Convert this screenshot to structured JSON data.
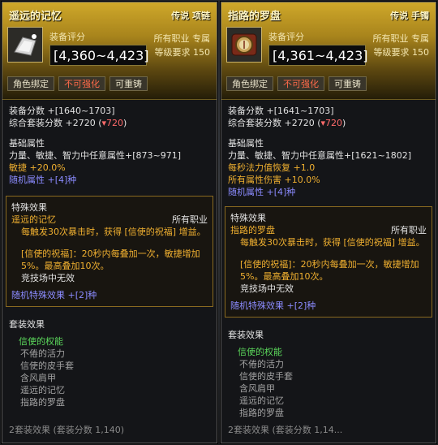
{
  "left": {
    "title": "遥远的记忆",
    "grade": "传说 项链",
    "score_label": "装备评分",
    "score": "[4,360~4,423]",
    "req_job": "所有职业 专属",
    "req_level": "等级要求 150",
    "tags": [
      "角色绑定",
      "不可强化",
      "可重铸"
    ],
    "equip_score": "装备分数 +[1640~1703]",
    "set_score_prefix": "综合套装分数 +2720 (",
    "set_score_delta": "▾720",
    "set_score_suffix": ")",
    "basic_title": "基础属性",
    "basic_1": "力量、敏捷、智力中任意属性+[873~971]",
    "basic_2": "敏捷 +20.0%",
    "basic_3": "随机属性 +[4]种",
    "special_title": "特殊效果",
    "special_name": "遥远的记忆",
    "special_job": "所有职业",
    "special_desc": "每触发30次暴击时，获得 [信使的祝福] 增益。",
    "buff_desc": "[信使的祝福]：20秒内每叠加一次，敏捷增加5%。最高叠加10次。",
    "pvp": "竞技场中无效",
    "random_special": "随机特殊效果 +[2]种",
    "set_title": "套装效果",
    "set_name": "信使的权能",
    "set_items": [
      "不倦的活力",
      "信使的皮手套",
      "含风肩甲",
      "遥远的记忆",
      "指路的罗盘"
    ],
    "footer": "2套装效果 (套装分数 1,140)"
  },
  "right": {
    "title": "指路的罗盘",
    "grade": "传说 手镯",
    "score_label": "装备评分",
    "score": "[4,361~4,423]",
    "req_job": "所有职业 专属",
    "req_level": "等级要求 150",
    "tags": [
      "角色绑定",
      "不可强化",
      "可重铸"
    ],
    "equip_score": "装备分数 +[1641~1703]",
    "set_score_prefix": "综合套装分数 +2720 (",
    "set_score_delta": "▾720",
    "set_score_suffix": ")",
    "basic_title": "基础属性",
    "basic_1": "力量、敏捷、智力中任意属性+[1621~1802]",
    "basic_2": "每秒法力值恢复 +1.0",
    "basic_3": "所有属性伤害 +10.0%",
    "basic_4": "随机属性 +[4]种",
    "special_title": "特殊效果",
    "special_name": "指路的罗盘",
    "special_job": "所有职业",
    "special_desc": "每触发30次暴击时，获得 [信使的祝福] 增益。",
    "buff_desc": "[信使的祝福]：20秒内每叠加一次，敏捷增加5%。最高叠加10次。",
    "pvp": "竞技场中无效",
    "random_special": "随机特殊效果 +[2]种",
    "set_title": "套装效果",
    "set_name": "信使的权能",
    "set_items": [
      "不倦的活力",
      "信使的皮手套",
      "含风肩甲",
      "遥远的记忆",
      "指路的罗盘"
    ],
    "footer": "2套装效果 (套装分数 1,14..."
  },
  "colors": {
    "legendary_gold": "#f0b030",
    "random_blue": "#8b8bff",
    "set_green": "#5bd75b",
    "negative_red": "#ff6b6b"
  }
}
